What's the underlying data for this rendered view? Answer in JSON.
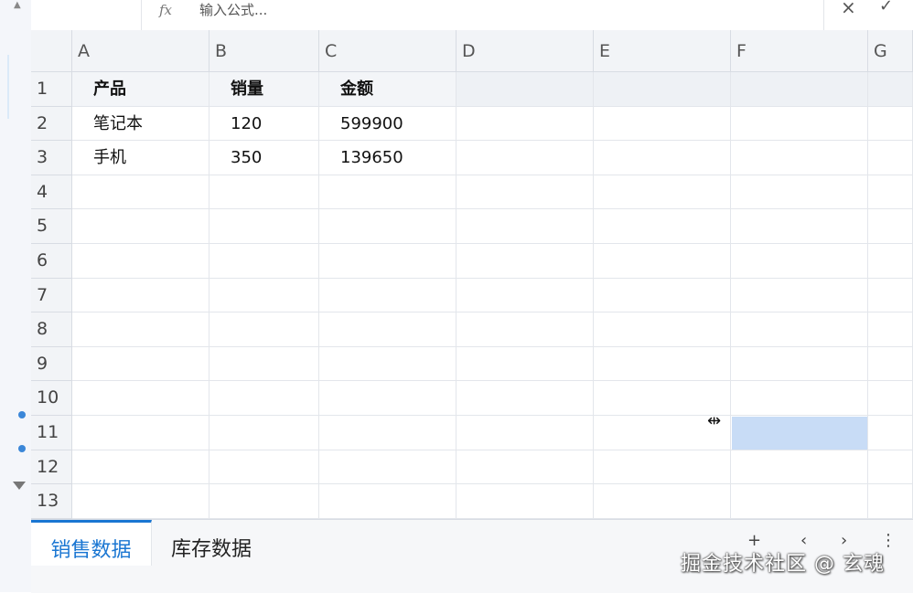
{
  "formula_bar": {
    "fx_label": "fx",
    "placeholder": "输入公式...",
    "cancel_icon": "×",
    "confirm_icon": "✓"
  },
  "columns": [
    "A",
    "B",
    "C",
    "D",
    "E",
    "F",
    "G"
  ],
  "rows": [
    "1",
    "2",
    "3",
    "4",
    "5",
    "6",
    "7",
    "8",
    "9",
    "10",
    "11",
    "12",
    "13"
  ],
  "cells": {
    "A1": "产品",
    "B1": "销量",
    "C1": "金额",
    "A2": "笔记本",
    "B2": "120",
    "C2": "599900",
    "A3": "手机",
    "B3": "350",
    "C3": "139650"
  },
  "selection": {
    "cell": "F11",
    "color": "#c8dcf6"
  },
  "sheet_tabs": [
    {
      "label": "销售数据",
      "active": true
    },
    {
      "label": "库存数据",
      "active": false
    }
  ],
  "tab_controls": {
    "add": "+",
    "prev": "‹",
    "next": "›",
    "more": "⋮"
  },
  "watermark": "掘金技术社区 @ 玄魂",
  "colors": {
    "accent": "#1a76d2",
    "selection": "#c8dcf6",
    "handle": "#3b87d8"
  }
}
